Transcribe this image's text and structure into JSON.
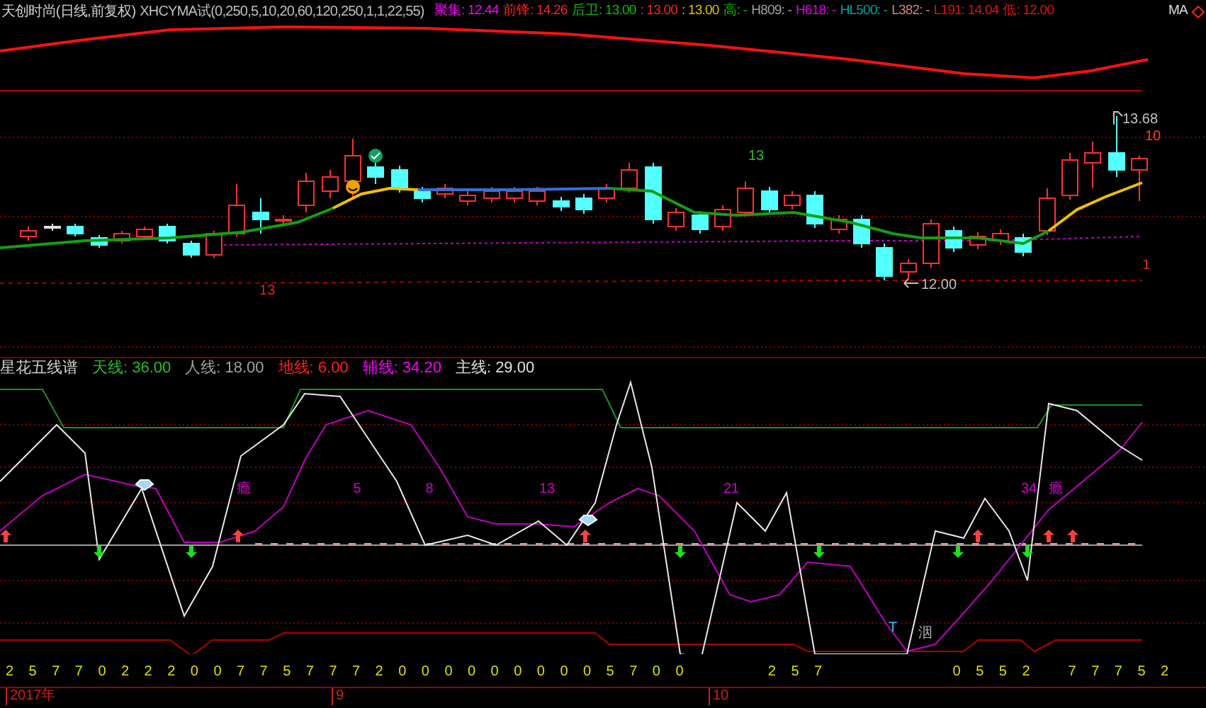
{
  "header": {
    "title": "天创时尚(日线,前复权)",
    "formula": "XHCYMA试(0,250,5,10,20,60,120,250,1,1,22,55)",
    "readings": [
      {
        "text": "聚集: 12.44",
        "color": "#ff00ff"
      },
      {
        "text": "前锋: 14.26",
        "color": "#ff2020"
      },
      {
        "text": "后卫: 13.00",
        "color": "#00c000"
      },
      {
        "text": ": 13.00",
        "color": "#ff2020"
      },
      {
        "text": ": 13.00",
        "color": "#e0c000"
      },
      {
        "text": "高: -",
        "color": "#00c000"
      },
      {
        "text": "H809: -",
        "color": "#a0a0a0"
      },
      {
        "text": "H618: -",
        "color": "#e000e0"
      },
      {
        "text": "HL500: -",
        "color": "#00a0a0"
      },
      {
        "text": "L382: -",
        "color": "#d08080"
      },
      {
        "text": "L191: 14.04",
        "color": "#e01010"
      },
      {
        "text": "低: 12.00",
        "color": "#e01010"
      }
    ],
    "ma_label": "MA"
  },
  "price_labels": [
    {
      "text": "13",
      "kind": "count",
      "color": "#e02020"
    },
    {
      "text": "13",
      "kind": "count",
      "color": "#20c020"
    },
    {
      "text": "13.68",
      "kind": "high"
    },
    {
      "text": "10",
      "kind": "count",
      "color": "#ff4010"
    },
    {
      "text": "1",
      "kind": "count",
      "color": "#e02020"
    },
    {
      "text": "12.00",
      "kind": "low"
    }
  ],
  "indicator": {
    "title": "星花五线谱",
    "readings": [
      {
        "text": "天线: 36.00",
        "color": "#20c020"
      },
      {
        "text": "人线: 18.00",
        "color": "#a0a0a0"
      },
      {
        "text": "地线: 6.00",
        "color": "#ff2020"
      },
      {
        "text": "辅线: 34.20",
        "color": "#ff00ff"
      },
      {
        "text": "主线: 29.00",
        "color": "#e0e0e0"
      }
    ],
    "labels": [
      "瘾",
      "5",
      "8",
      "13",
      "21",
      "34",
      "瘾"
    ],
    "t_mark": "T",
    "t_glyph": "洇"
  },
  "digit_groups": [
    [
      "2",
      "5",
      "7",
      "7",
      "0",
      "2",
      "2",
      "2",
      "0",
      "0",
      "7",
      "7",
      "5",
      "7",
      "7",
      "7",
      "2",
      "0",
      "0",
      "0",
      "0",
      "0",
      "0",
      "0",
      "0",
      "0",
      "5",
      "7",
      "0",
      "0"
    ],
    [
      "2",
      "5",
      "7"
    ],
    [
      "0",
      "5",
      "5",
      "2"
    ],
    [
      "7",
      "7",
      "7",
      "5",
      "2"
    ]
  ],
  "time_axis": [
    "2017年",
    "9",
    "10"
  ]
}
